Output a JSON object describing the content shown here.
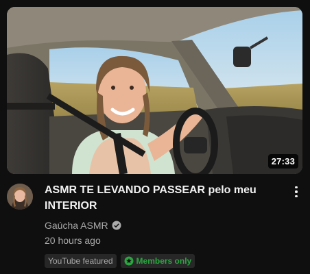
{
  "video": {
    "title": "ASMR TE LEVANDO PASSEAR pelo meu INTERIOR",
    "duration": "27:33",
    "channel": "Gaúcha ASMR",
    "published": "20 hours ago",
    "badges": {
      "featured": "YouTube featured",
      "members": "Members only"
    }
  },
  "colors": {
    "background": "#0f0f0f",
    "members_accent": "#2ba640",
    "secondary_text": "#aaaaaa"
  },
  "icons": [
    "verified-check-icon",
    "members-star-icon",
    "more-vert-icon"
  ]
}
